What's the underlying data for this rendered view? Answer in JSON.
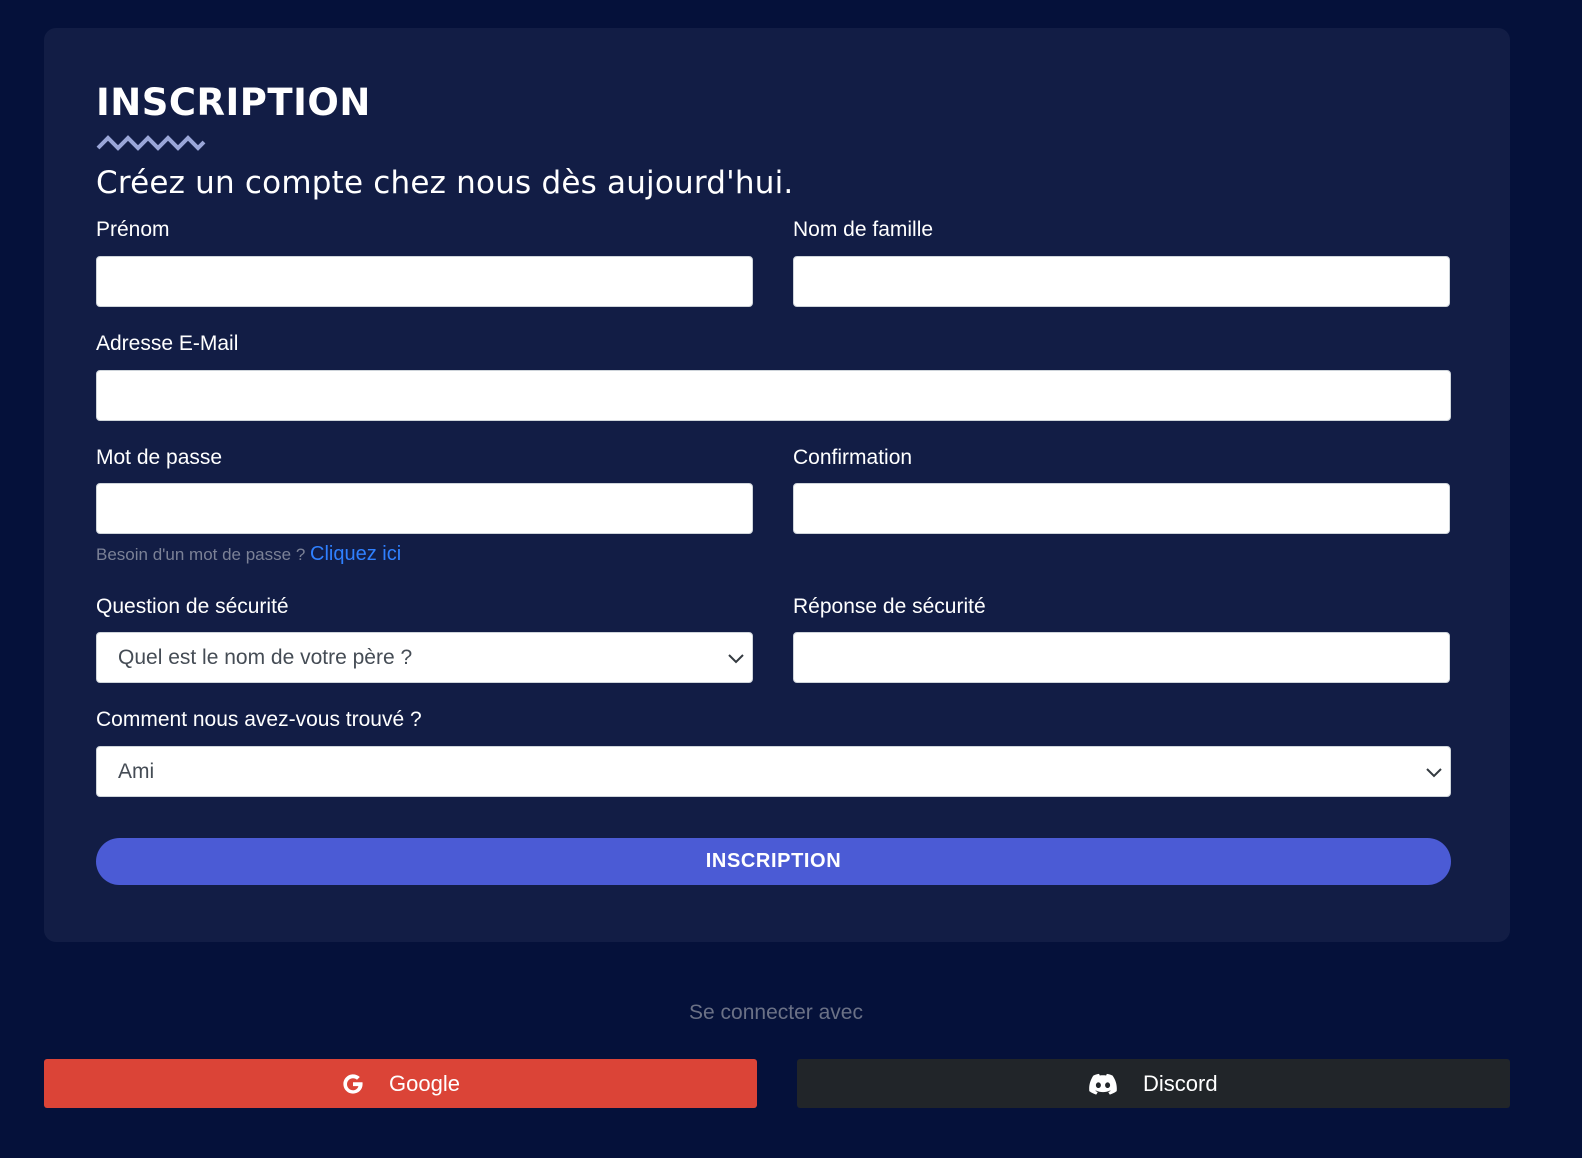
{
  "form": {
    "title": "INSCRIPTION",
    "subtitle": "Créez un compte chez nous dès aujourd'hui.",
    "fields": {
      "first_name": {
        "label": "Prénom",
        "value": ""
      },
      "last_name": {
        "label": "Nom de famille",
        "value": ""
      },
      "email": {
        "label": "Adresse E-Mail",
        "value": ""
      },
      "password": {
        "label": "Mot de passe",
        "value": ""
      },
      "confirmation": {
        "label": "Confirmation",
        "value": ""
      },
      "security_question": {
        "label": "Question de sécurité",
        "selected": "Quel est le nom de votre père ?"
      },
      "security_answer": {
        "label": "Réponse de sécurité",
        "value": ""
      },
      "referral": {
        "label": "Comment nous avez-vous trouvé ?",
        "selected": "Ami"
      }
    },
    "password_hint": {
      "text": "Besoin d'un mot de passe ?",
      "link": "Cliquez ici"
    },
    "submit_label": "INSCRIPTION"
  },
  "social": {
    "caption": "Se connecter avec",
    "google": {
      "label": "Google",
      "icon": "google-icon",
      "color": "#db4437"
    },
    "discord": {
      "label": "Discord",
      "icon": "discord-icon",
      "color": "#212529"
    }
  },
  "colors": {
    "page_background": "#05113a",
    "card_background": "#121d45",
    "accent": "#4b5bd5",
    "link": "#2f80ff"
  }
}
